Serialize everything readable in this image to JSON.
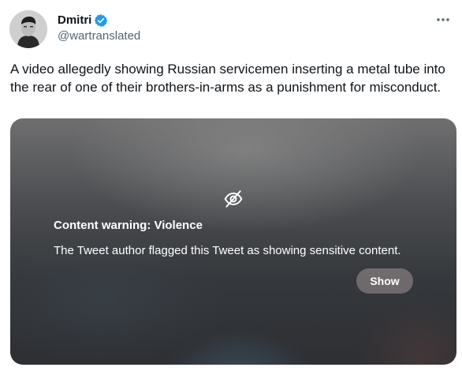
{
  "author": {
    "display_name": "Dmitri",
    "handle": "@wartranslated",
    "verified_icon": "verified-badge-icon",
    "verified_color": "#1d9bf0"
  },
  "menu": {
    "icon": "more-horizontal-icon"
  },
  "tweet": {
    "text": "A video allegedly showing Russian servicemen inserting a metal tube into the rear of one of their brothers-in-arms as a punishment for misconduct."
  },
  "media": {
    "icon": "eye-slash-icon",
    "warning_title": "Content warning: Violence",
    "warning_text": "The Tweet author flagged this Tweet as showing sensitive content.",
    "show_label": "Show"
  },
  "colors": {
    "text_primary": "#0f1419",
    "text_secondary": "#536471"
  }
}
